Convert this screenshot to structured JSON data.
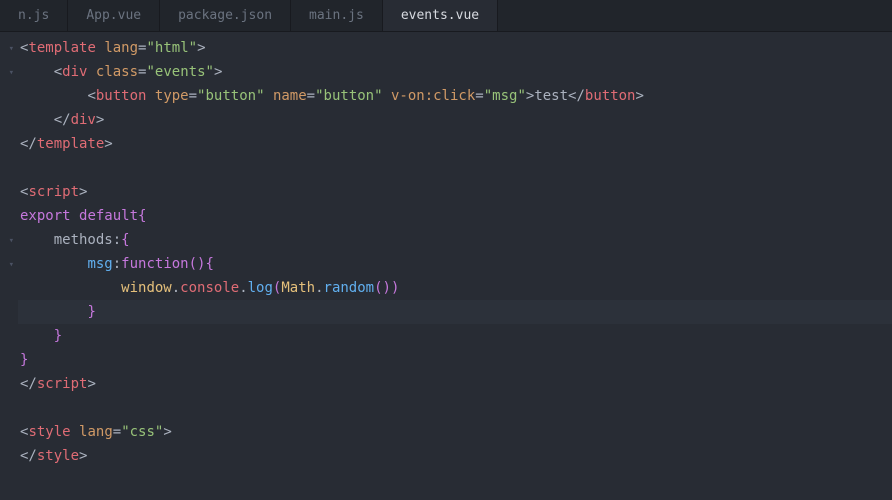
{
  "tabs": [
    {
      "label": "n.js",
      "active": false
    },
    {
      "label": "App.vue",
      "active": false
    },
    {
      "label": "package.json",
      "active": false
    },
    {
      "label": "main.js",
      "active": false
    },
    {
      "label": "events.vue",
      "active": true
    }
  ],
  "code": {
    "l1": {
      "open": "<",
      "tag": "template",
      "sp": " ",
      "attr": "lang",
      "eq": "=",
      "q1": "\"",
      "val": "html",
      "q2": "\"",
      "close": ">"
    },
    "l2": {
      "open": "<",
      "tag": "div",
      "sp": " ",
      "attr": "class",
      "eq": "=",
      "q1": "\"",
      "val": "events",
      "q2": "\"",
      "close": ">"
    },
    "l3": {
      "open": "<",
      "tag": "button",
      "sp1": " ",
      "a1": "type",
      "eq1": "=",
      "q1a": "\"",
      "v1": "button",
      "q1b": "\"",
      "sp2": " ",
      "a2": "name",
      "eq2": "=",
      "q2a": "\"",
      "v2": "button",
      "q2b": "\"",
      "sp3": " ",
      "a3": "v-on:click",
      "eq3": "=",
      "q3a": "\"",
      "v3": "msg",
      "q3b": "\"",
      "close1": ">",
      "text": "test",
      "open2": "</",
      "tag2": "button",
      "close2": ">"
    },
    "l4": {
      "open": "</",
      "tag": "div",
      "close": ">"
    },
    "l5": {
      "open": "</",
      "tag": "template",
      "close": ">"
    },
    "l7": {
      "open": "<",
      "tag": "script",
      "close": ">"
    },
    "l8": {
      "kw": "export",
      "sp": " ",
      "def": "default",
      "brace": "{"
    },
    "l9": {
      "name": "methods",
      "colon": ":",
      "brace": "{"
    },
    "l10": {
      "name": "msg",
      "colon": ":",
      "kw": "function",
      "paren": "()",
      "brace": "{"
    },
    "l11": {
      "win": "window",
      "d1": ".",
      "con": "console",
      "d2": ".",
      "log": "log",
      "po": "(",
      "math": "Math",
      "d3": ".",
      "rnd": "random",
      "pp": "()",
      "pc": ")"
    },
    "l12": {
      "brace": "}"
    },
    "l13": {
      "brace": "}"
    },
    "l14": {
      "brace": "}"
    },
    "l15": {
      "open": "</",
      "tag": "script",
      "close": ">"
    },
    "l17": {
      "open": "<",
      "tag": "style",
      "sp": " ",
      "attr": "lang",
      "eq": "=",
      "q1": "\"",
      "val": "css",
      "q2": "\"",
      "close": ">"
    },
    "l18": {
      "open": "</",
      "tag": "style",
      "close": ">"
    }
  }
}
